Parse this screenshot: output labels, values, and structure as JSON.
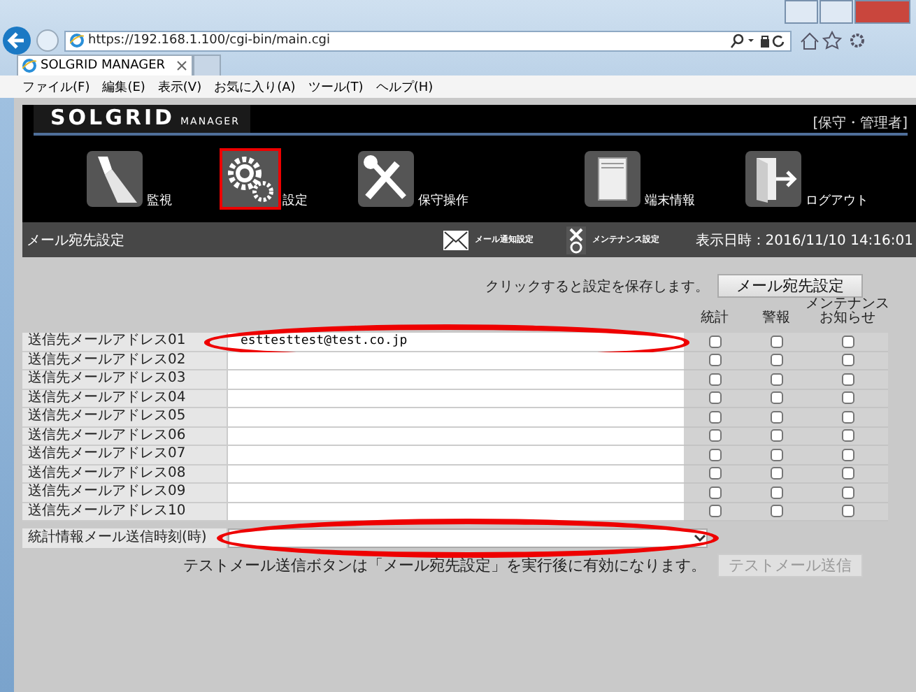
{
  "browser": {
    "address": "https://192.168.1.100/cgi-bin/main.cgi",
    "tab_title": "SOLGRID MANAGER",
    "menu": [
      "ファイル(F)",
      "編集(E)",
      "表示(V)",
      "お気に入り(A)",
      "ツール(T)",
      "ヘルプ(H)"
    ]
  },
  "header": {
    "logo": "SOLGRID",
    "logo_sub": "MANAGER",
    "role": "[保守・管理者]",
    "nav": [
      {
        "label": "監視",
        "selected": false
      },
      {
        "label": "設定",
        "selected": true
      },
      {
        "label": "保守操作",
        "selected": false
      },
      {
        "label": "端末情報",
        "selected": false
      },
      {
        "label": "ログアウト",
        "selected": false
      }
    ]
  },
  "subbar": {
    "title": "メール宛先設定",
    "links": [
      {
        "label": "メール通知設定"
      },
      {
        "label": "メンテナンス設定"
      }
    ],
    "datetime": "表示日時：2016/11/10 14:16:01"
  },
  "form": {
    "save_hint": "クリックすると設定を保存します。",
    "save_button": "メール宛先設定",
    "columns": [
      {
        "lines": [
          "統計"
        ]
      },
      {
        "lines": [
          "警報"
        ]
      },
      {
        "lines": [
          "メンテナンス",
          "お知らせ"
        ]
      }
    ],
    "rows": [
      {
        "label": "送信先メールアドレス01",
        "value": "esttesttest@test.co.jp",
        "checks": [
          false,
          false,
          false
        ],
        "highlighted": true
      },
      {
        "label": "送信先メールアドレス02",
        "value": "",
        "checks": [
          false,
          false,
          false
        ],
        "highlighted": false
      },
      {
        "label": "送信先メールアドレス03",
        "value": "",
        "checks": [
          false,
          false,
          false
        ],
        "highlighted": false
      },
      {
        "label": "送信先メールアドレス04",
        "value": "",
        "checks": [
          false,
          false,
          false
        ],
        "highlighted": false
      },
      {
        "label": "送信先メールアドレス05",
        "value": "",
        "checks": [
          false,
          false,
          false
        ],
        "highlighted": false
      },
      {
        "label": "送信先メールアドレス06",
        "value": "",
        "checks": [
          false,
          false,
          false
        ],
        "highlighted": false
      },
      {
        "label": "送信先メールアドレス07",
        "value": "",
        "checks": [
          false,
          false,
          false
        ],
        "highlighted": false
      },
      {
        "label": "送信先メールアドレス08",
        "value": "",
        "checks": [
          false,
          false,
          false
        ],
        "highlighted": false
      },
      {
        "label": "送信先メールアドレス09",
        "value": "",
        "checks": [
          false,
          false,
          false
        ],
        "highlighted": false
      },
      {
        "label": "送信先メールアドレス10",
        "value": "",
        "checks": [
          false,
          false,
          false
        ],
        "highlighted": false
      }
    ],
    "time_label": "統計情報メール送信時刻(時)",
    "time_highlighted": true,
    "note": "テストメール送信ボタンは「メール宛先設定」を実行後に有効になります。",
    "test_button": "テストメール送信",
    "test_disabled": true
  }
}
